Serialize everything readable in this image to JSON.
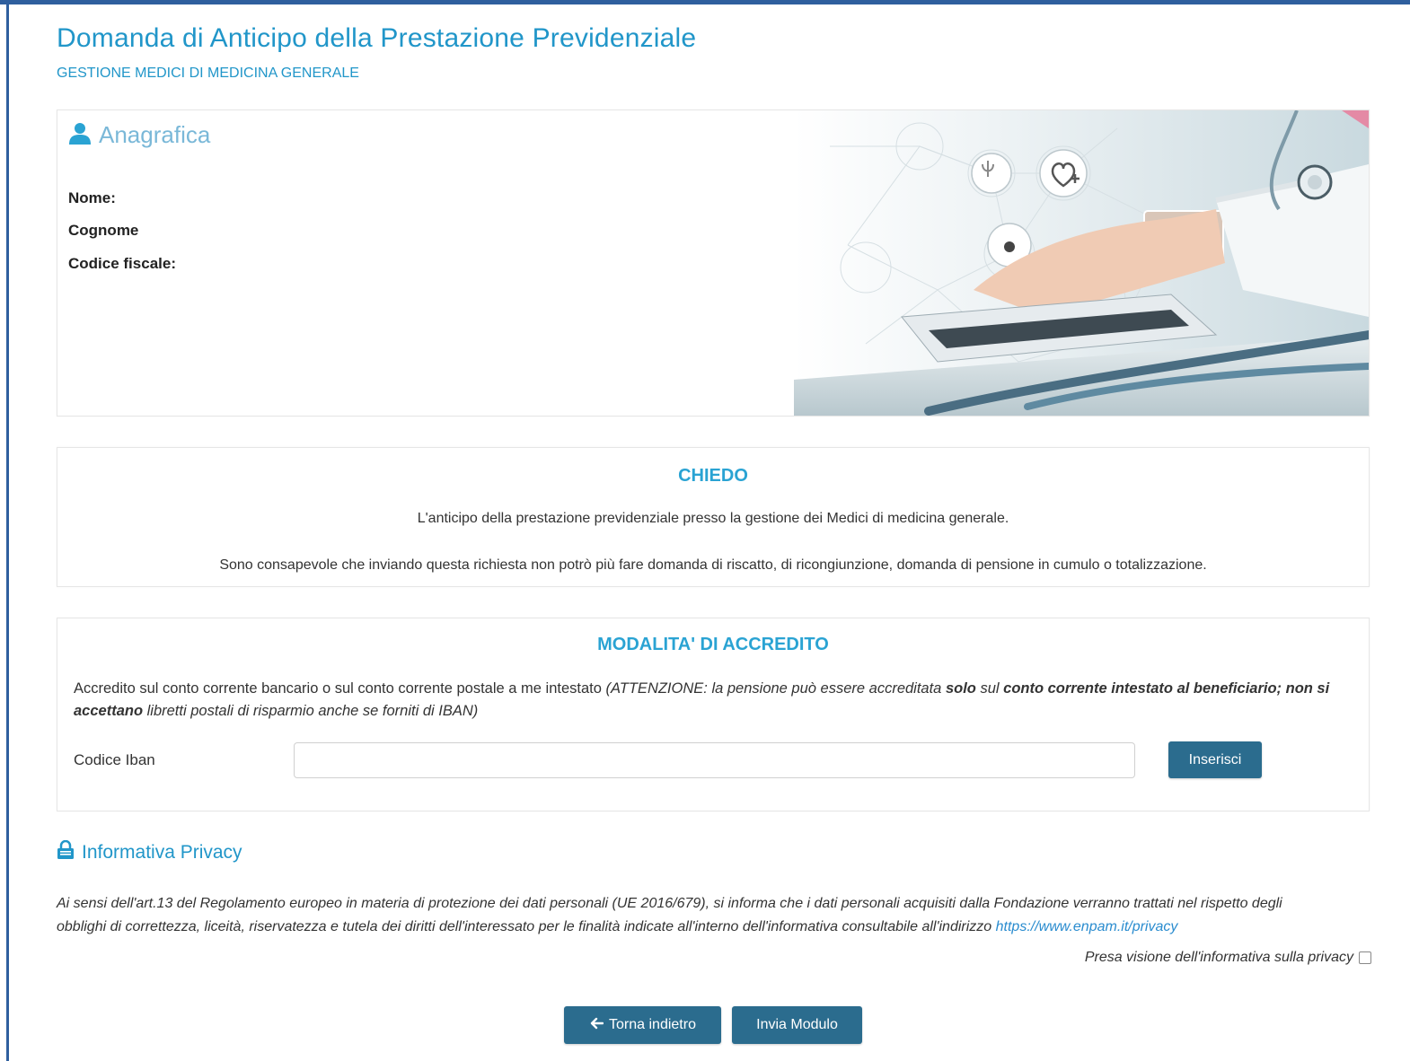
{
  "header": {
    "title": "Domanda di Anticipo della Prestazione Previdenziale",
    "subtitle": "GESTIONE MEDICI DI MEDICINA GENERALE"
  },
  "anagrafica": {
    "title": "Anagrafica",
    "icon": "user-icon",
    "fields": {
      "nome_label": "Nome:",
      "cognome_label": "Cognome",
      "codice_fiscale_label": "Codice fiscale:"
    }
  },
  "chiedo": {
    "title": "CHIEDO",
    "line1": "L'anticipo della prestazione previdenziale presso la gestione dei Medici di medicina generale.",
    "line2": "Sono consapevole che inviando questa richiesta non potrò più fare domanda di riscatto, di ricongiunzione, domanda di pensione in cumulo o totalizzazione."
  },
  "modalita": {
    "title": "MODALITA' DI ACCREDITO",
    "text_normal": "Accredito sul conto corrente bancario o sul conto corrente postale a me intestato ",
    "text_italic_1": "(ATTENZIONE: la pensione può essere accreditata ",
    "text_bold_1": "solo",
    "text_italic_2": " sul ",
    "text_bold_2": "conto corrente intestato al beneficiario; non si accettano",
    "text_italic_3": " libretti postali di risparmio anche se forniti di IBAN)",
    "iban_label": "Codice Iban",
    "iban_value": "",
    "insert_button": "Inserisci"
  },
  "privacy": {
    "title": "Informativa Privacy",
    "icon": "lock-icon",
    "text": "Ai sensi dell'art.13 del Regolamento europeo in materia di protezione dei dati personali (UE 2016/679), si informa che i dati personali acquisiti dalla Fondazione verranno trattati nel rispetto degli obblighi di correttezza, liceità, riservatezza e tutela dei diritti dell'interessato per le finalità indicate all'interno dell'informativa consultabile all'indirizzo ",
    "link": "https://www.enpam.it/privacy",
    "checkbox_label": "Presa visione dell'informativa sulla privacy"
  },
  "actions": {
    "back_label": "Torna indietro",
    "send_label": "Invia Modulo"
  },
  "colors": {
    "title_blue": "#2196c9",
    "button_blue": "#2b6c8e",
    "frame_blue": "#2f5f9e"
  }
}
